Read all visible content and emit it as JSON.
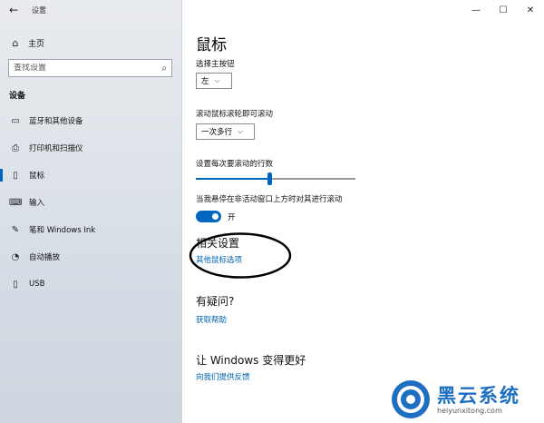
{
  "app": {
    "title": "设置"
  },
  "window_controls": {
    "minimize": "—",
    "maximize": "☐",
    "close": "✕",
    "back": "←"
  },
  "sidebar": {
    "home": {
      "label": "主页",
      "icon": "home-icon"
    },
    "search": {
      "placeholder": "查找设置",
      "icon": "search-icon"
    },
    "section_header": "设备",
    "items": [
      {
        "label": "蓝牙和其他设备",
        "icon": "bluetooth-devices-icon",
        "selected": false
      },
      {
        "label": "打印机和扫描仪",
        "icon": "printer-icon",
        "selected": false
      },
      {
        "label": "鼠标",
        "icon": "mouse-icon",
        "selected": true
      },
      {
        "label": "输入",
        "icon": "keyboard-icon",
        "selected": false
      },
      {
        "label": "笔和 Windows Ink",
        "icon": "pen-icon",
        "selected": false
      },
      {
        "label": "自动播放",
        "icon": "autoplay-icon",
        "selected": false
      },
      {
        "label": "USB",
        "icon": "usb-icon",
        "selected": false
      }
    ]
  },
  "main": {
    "title": "鼠标",
    "primary_button": {
      "label": "选择主按钮",
      "value": "左"
    },
    "scroll_wheel": {
      "label": "滚动鼠标滚轮即可滚动",
      "value": "一次多行"
    },
    "lines_to_scroll": {
      "label": "设置每次要滚动的行数",
      "value_fraction": 0.46
    },
    "inactive_scroll": {
      "label": "当我悬停在非活动窗口上方时对其进行滚动",
      "state_label": "开",
      "on": true
    },
    "related": {
      "heading": "相关设置",
      "link": "其他鼠标选项"
    },
    "help": {
      "heading": "有疑问?",
      "link": "获取帮助"
    },
    "feedback": {
      "heading": "让 Windows 变得更好",
      "link": "向我们提供反馈"
    }
  },
  "watermark": {
    "brand": "黑云系统",
    "url": "heiyunxitong.com"
  },
  "colors": {
    "accent": "#0067c0",
    "link": "#0063b1",
    "watermark": "#1e6fc2"
  }
}
